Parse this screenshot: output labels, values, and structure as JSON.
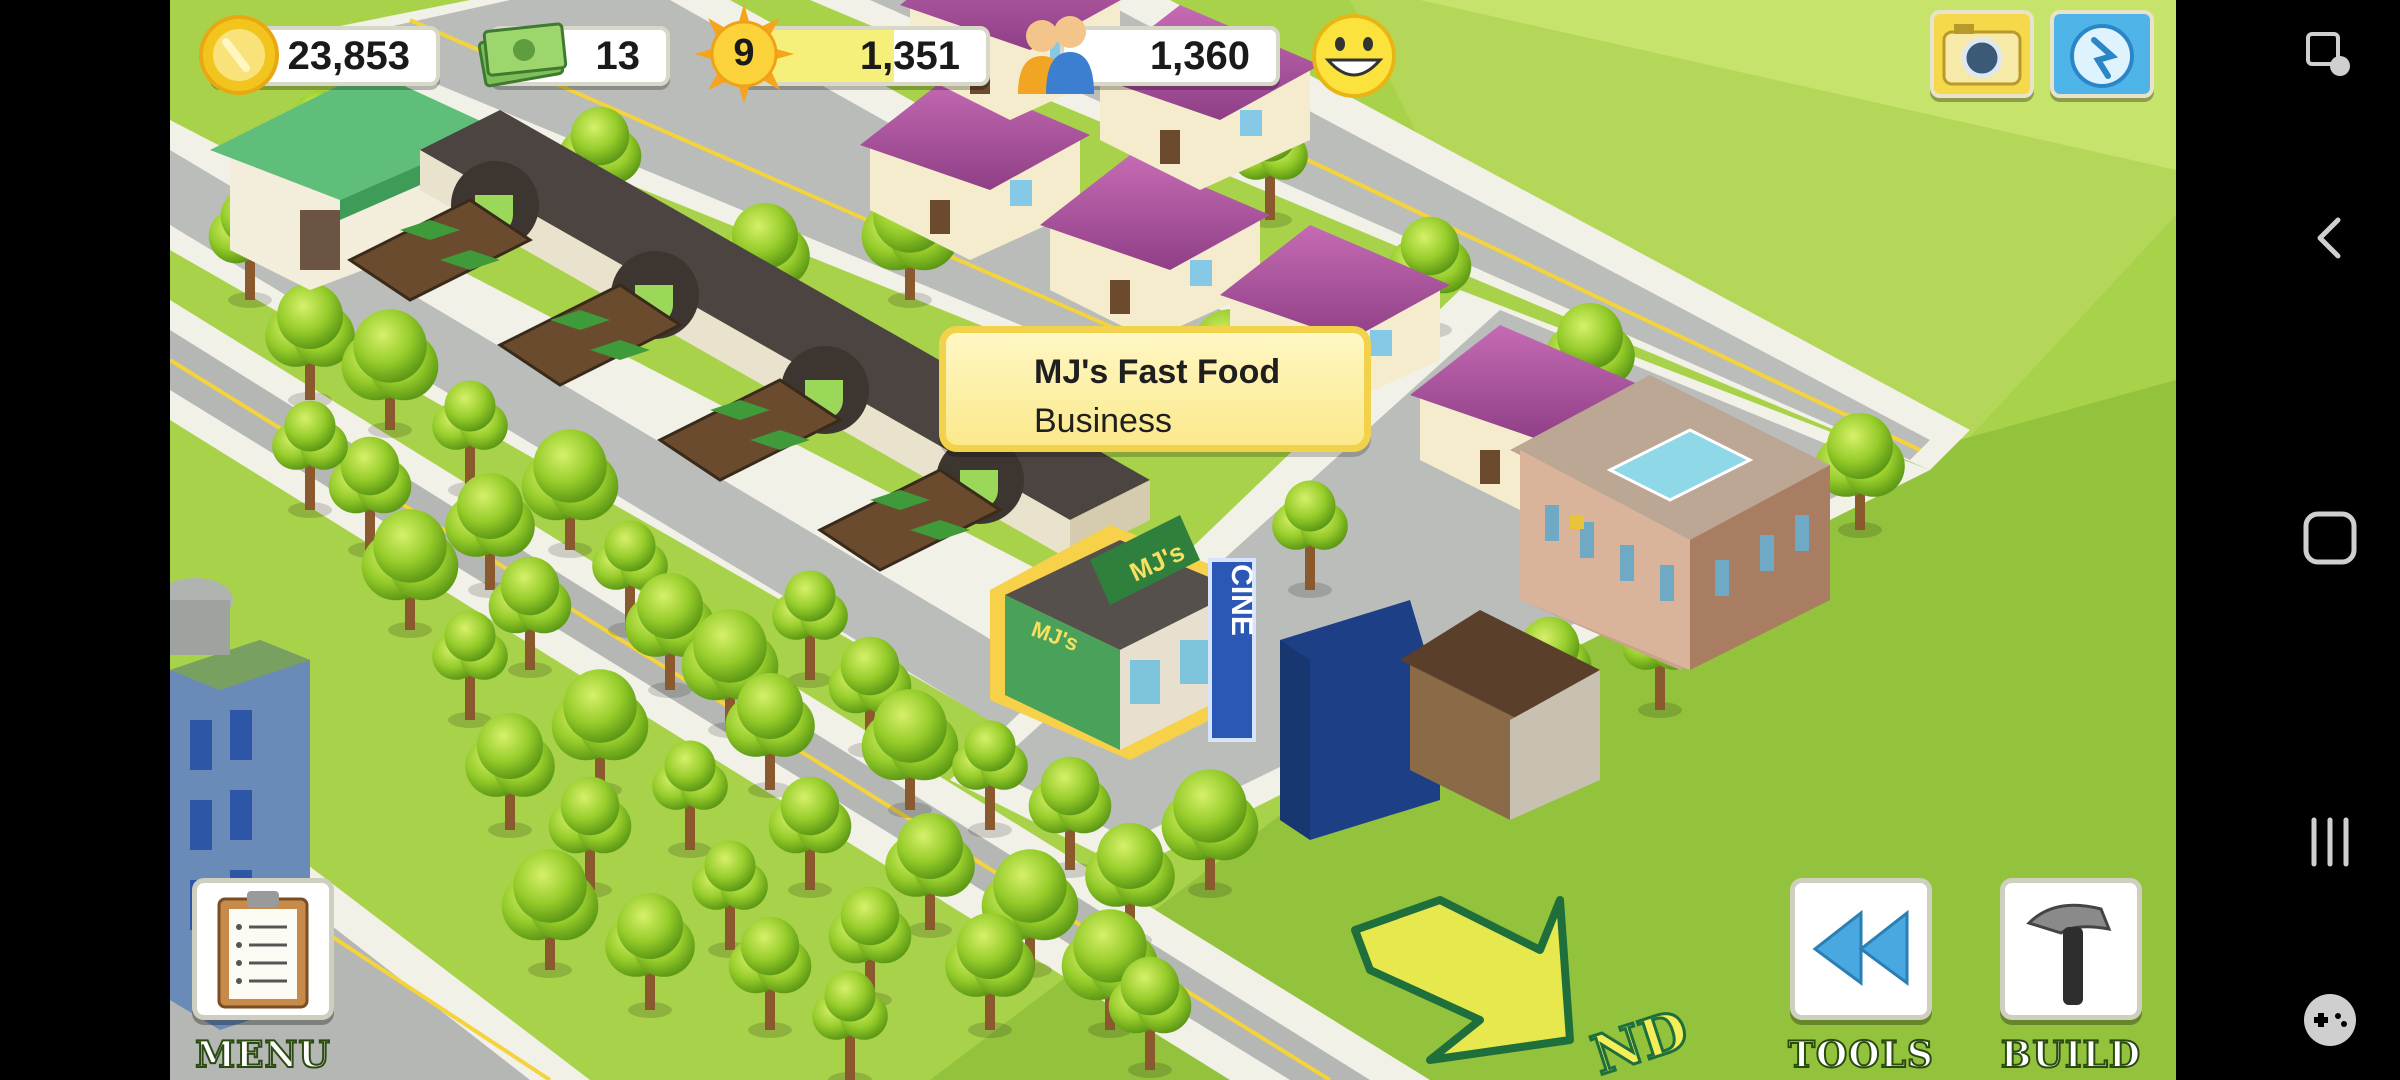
{
  "hud": {
    "coins": "23,853",
    "cash": "13",
    "level": "9",
    "xp": "1,351",
    "xp_progress": 0.62,
    "population": "1,360"
  },
  "tooltip": {
    "title": "MJ's Fast Food",
    "subtitle": "Business"
  },
  "buildings": {
    "mjs_sign": "MJ's",
    "cinema_sign": "CINE"
  },
  "arrow_text": "ND",
  "buttons": {
    "menu": "MENU",
    "tools": "TOOLS",
    "build": "BUILD"
  },
  "icons": {
    "coin": "gold-coin-icon",
    "cash": "cash-bills-icon",
    "level": "sun-star-icon",
    "population": "people-icon",
    "happiness": "smiley-face-icon",
    "camera": "camera-icon",
    "share": "share-icon",
    "menu": "clipboard-icon",
    "tools": "rewind-icon",
    "build": "hammer-icon"
  },
  "colors": {
    "grass": "#9fcf3a",
    "road": "#b9bcb9",
    "sidewalk": "#f2f1e8",
    "tooltip_border": "#f1d24a",
    "accent_yellow": "#f6ef7a"
  }
}
